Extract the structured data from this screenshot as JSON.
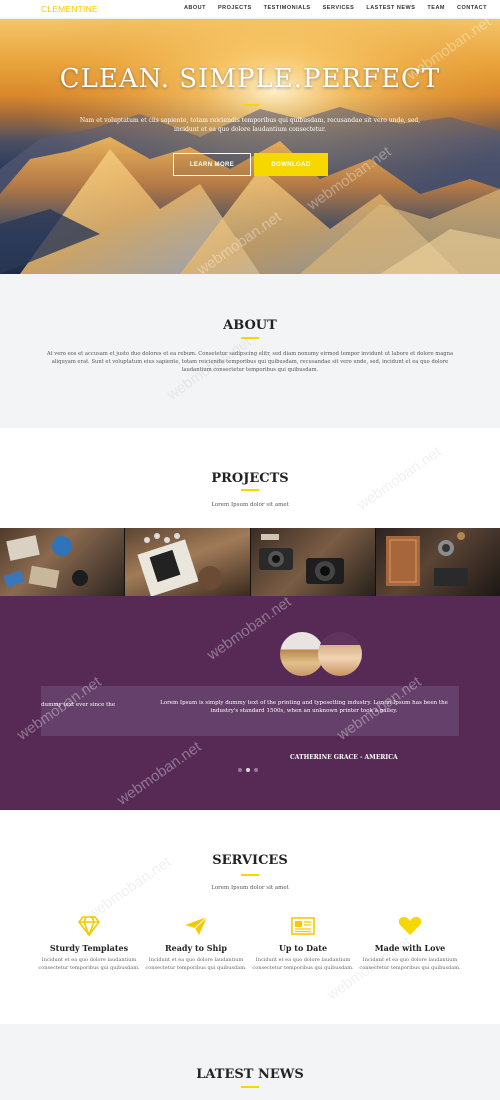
{
  "nav": {
    "brand": "CLEMENTINE",
    "items": [
      "ABOUT",
      "PROJECTS",
      "TESTIMONIALS",
      "SERVICES",
      "LASTEST NEWS",
      "TEAM",
      "CONTACT"
    ]
  },
  "hero": {
    "title": "CLEAN. SIMPLE.PERFECT",
    "subtitle": "Nam et voluptatum et ciis sapiente, totam reiciendis temporibus qui quibusdam, recusandae sit vero unde, sed, incidunt et ea quo dolore laudantium consectetur.",
    "learn_more": "LEARN MORE",
    "download": "DOWNLOAD"
  },
  "about": {
    "title": "ABOUT",
    "text": "At vero eos et accusam et justo duo dolores et ea rebum. Consetetur sadipscing elitr, sed diam nonumy eirmod tempor invidunt ut labore et dolore magna aliquyam erat. Sunt et voluptatum eius sapiente, totam reiciendis temporibus qui quibusdam, recusandae sit vero unde, sed, incidunt et ea quo dolore laudantium consectetur temporibus qui quibusdam."
  },
  "projects": {
    "title": "PROJECTS",
    "subtitle": "Lorem Ipsum dolor sit amet"
  },
  "testimonial": {
    "left_text": "dummy text ever since the",
    "quote": "Lorem Ipsum is simply dummy text of the printing and typesetting industry. Lorem Ipsum has been the industry's standard 1500s, when an unknown printer took a galley.",
    "author": "CATHERINE GRACE - AMERICA"
  },
  "services": {
    "title": "SERVICES",
    "subtitle": "Lorem Ipsum dolor sit amet",
    "items": [
      {
        "name": "Sturdy Templates",
        "desc": "Incidunt et ea quo dolore laudantium consectetur temporibus qui quibusdam.",
        "icon": "diamond-icon"
      },
      {
        "name": "Ready to Ship",
        "desc": "Incidunt et ea quo dolore laudantium consectetur temporibus qui quibusdam.",
        "icon": "paper-plane-icon"
      },
      {
        "name": "Up to Date",
        "desc": "Incidunt et ea quo dolore laudantium consectetur temporibus qui quibusdam.",
        "icon": "newspaper-icon"
      },
      {
        "name": "Made with Love",
        "desc": "Incidunt et ea quo dolore laudantium consectetur temporibus qui quibusdam.",
        "icon": "heart-icon"
      }
    ]
  },
  "news": {
    "title": "LATEST NEWS"
  },
  "watermark": "webmoban.net",
  "colors": {
    "accent": "#f7d700",
    "brand": "#f7c900",
    "testimonial_bg": "#562a55"
  }
}
